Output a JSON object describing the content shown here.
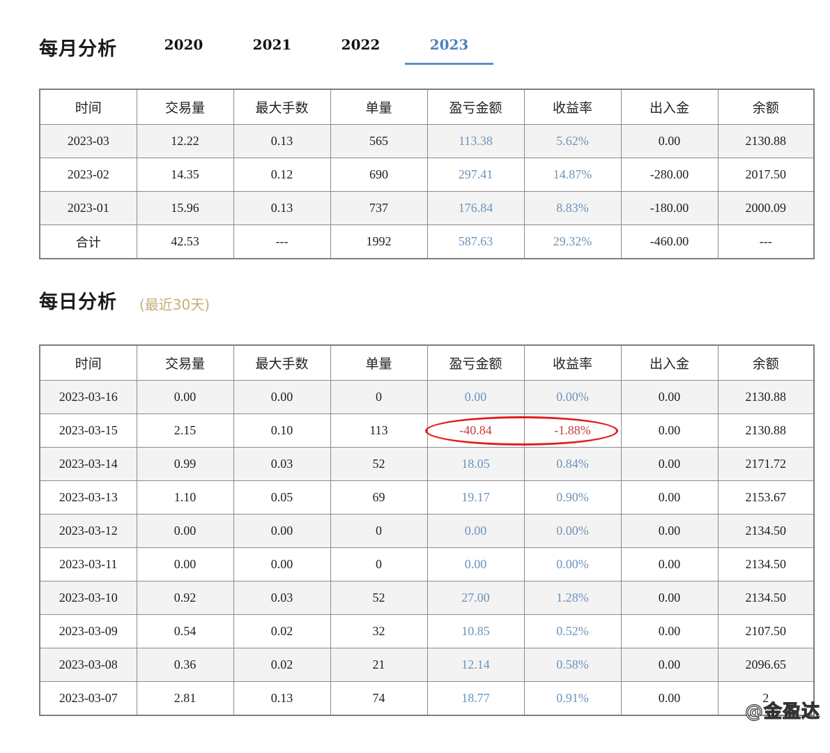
{
  "monthly": {
    "title": "每月分析",
    "years": [
      "2020",
      "2021",
      "2022",
      "2023"
    ],
    "active_year": "2023",
    "columns": [
      "时间",
      "交易量",
      "最大手数",
      "单量",
      "盈亏金额",
      "收益率",
      "出入金",
      "余额"
    ],
    "rows": [
      [
        "2023-03",
        "12.22",
        "0.13",
        "565",
        "113.38",
        "5.62%",
        "0.00",
        "2130.88"
      ],
      [
        "2023-02",
        "14.35",
        "0.12",
        "690",
        "297.41",
        "14.87%",
        "-280.00",
        "2017.50"
      ],
      [
        "2023-01",
        "15.96",
        "0.13",
        "737",
        "176.84",
        "8.83%",
        "-180.00",
        "2000.09"
      ],
      [
        "合计",
        "42.53",
        "---",
        "1992",
        "587.63",
        "29.32%",
        "-460.00",
        "---"
      ]
    ]
  },
  "daily": {
    "title": "每日分析",
    "subtitle": "(最近30天)",
    "columns": [
      "时间",
      "交易量",
      "最大手数",
      "单量",
      "盈亏金额",
      "收益率",
      "出入金",
      "余额"
    ],
    "rows": [
      [
        "2023-03-16",
        "0.00",
        "0.00",
        "0",
        "0.00",
        "0.00%",
        "0.00",
        "2130.88"
      ],
      [
        "2023-03-15",
        "2.15",
        "0.10",
        "113",
        "-40.84",
        "-1.88%",
        "0.00",
        "2130.88"
      ],
      [
        "2023-03-14",
        "0.99",
        "0.03",
        "52",
        "18.05",
        "0.84%",
        "0.00",
        "2171.72"
      ],
      [
        "2023-03-13",
        "1.10",
        "0.05",
        "69",
        "19.17",
        "0.90%",
        "0.00",
        "2153.67"
      ],
      [
        "2023-03-12",
        "0.00",
        "0.00",
        "0",
        "0.00",
        "0.00%",
        "0.00",
        "2134.50"
      ],
      [
        "2023-03-11",
        "0.00",
        "0.00",
        "0",
        "0.00",
        "0.00%",
        "0.00",
        "2134.50"
      ],
      [
        "2023-03-10",
        "0.92",
        "0.03",
        "52",
        "27.00",
        "1.28%",
        "0.00",
        "2134.50"
      ],
      [
        "2023-03-09",
        "0.54",
        "0.02",
        "32",
        "10.85",
        "0.52%",
        "0.00",
        "2107.50"
      ],
      [
        "2023-03-08",
        "0.36",
        "0.02",
        "21",
        "12.14",
        "0.58%",
        "0.00",
        "2096.65"
      ],
      [
        "2023-03-07",
        "2.81",
        "0.13",
        "74",
        "18.77",
        "0.91%",
        "0.00",
        "2"
      ]
    ]
  },
  "watermark": "@金盈达",
  "colors": {
    "tab_active": "#4a82b8",
    "profit_blue": "#6b94bb",
    "loss_red": "#c83d3d",
    "highlight_circle": "#e21d1d",
    "subtitle_gold": "#c8ac7a"
  }
}
